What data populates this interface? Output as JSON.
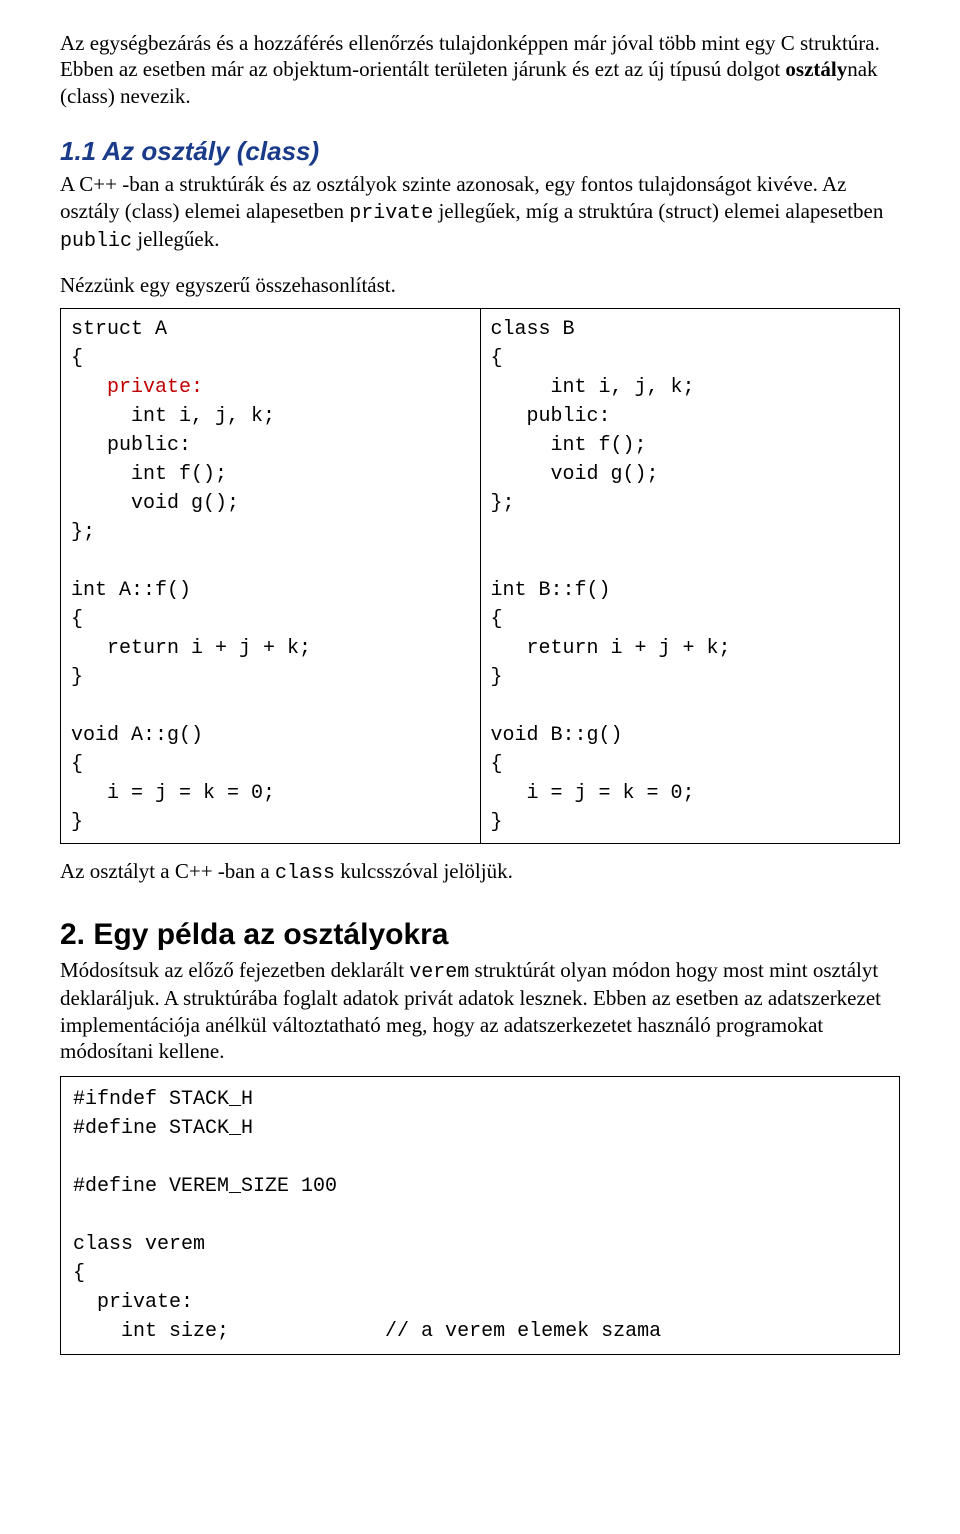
{
  "intro": {
    "p1_a": "Az egységbezárás és a hozzáférés ellenőrzés tulajdonképpen már jóval több mint egy C struktúra. Ebben az esetben már az objektum-orientált területen járunk és ezt az új típusú dolgot ",
    "p1_b_bold": "osztály",
    "p1_c": "nak (class) nevezik."
  },
  "sec1": {
    "title": "1.1 Az osztály (class)",
    "p1_a": "A C++ -ban a struktúrák és az osztályok szinte azonosak, egy fontos tulajdonságot kivéve. Az osztály (class) elemei alapesetben ",
    "p1_code1": "private",
    "p1_b": " jellegűek, míg a struktúra (struct) elemei alapesetben ",
    "p1_code2": "public",
    "p1_c": " jellegűek.",
    "p2": "Nézzünk egy egyszerű összehasonlítást."
  },
  "code_compare": {
    "left": {
      "l1": "struct A",
      "l2": "{",
      "l3_pre": "   ",
      "l3_red": "private:",
      "l4": "     int i, j, k;",
      "l5": "   public:",
      "l6": "     int f();",
      "l7": "     void g();",
      "l8": "};",
      "l9": "",
      "l10": "int A::f()",
      "l11": "{",
      "l12": "   return i + j + k;",
      "l13": "}",
      "l14": "",
      "l15": "void A::g()",
      "l16": "{",
      "l17": "   i = j = k = 0;",
      "l18": "}"
    },
    "right": {
      "r1": "class B",
      "r2": "{",
      "r3": "     int i, j, k;",
      "r4": "   public:",
      "r5": "     int f();",
      "r6": "     void g();",
      "r7": "};",
      "r8": "",
      "r9": "",
      "r10": "int B::f()",
      "r11": "{",
      "r12": "   return i + j + k;",
      "r13": "}",
      "r14": "",
      "r15": "void B::g()",
      "r16": "{",
      "r17": "   i = j = k = 0;",
      "r18": "}"
    }
  },
  "after_table": {
    "a": "Az osztályt a C++ -ban a ",
    "code": "class",
    "b": " kulcsszóval jelöljük."
  },
  "sec2": {
    "title": "2. Egy példa az osztályokra",
    "p_a": "Módosítsuk az előző fejezetben deklarált ",
    "p_code": "verem",
    "p_b": " struktúrát olyan módon hogy most mint osztályt deklaráljuk. A struktúrába foglalt adatok privát adatok lesznek. Ebben az esetben az adatszerkezet implementációja anélkül változtatható meg, hogy az adatszerkezetet használó programokat módosítani kellene."
  },
  "codebox": {
    "c1": "#ifndef STACK_H",
    "c2": "#define STACK_H",
    "c3": "",
    "c4": "#define VEREM_SIZE 100",
    "c5": "",
    "c6": "class verem",
    "c7": "{",
    "c8": "  private:",
    "c9": "    int size;             // a verem elemek szama"
  }
}
